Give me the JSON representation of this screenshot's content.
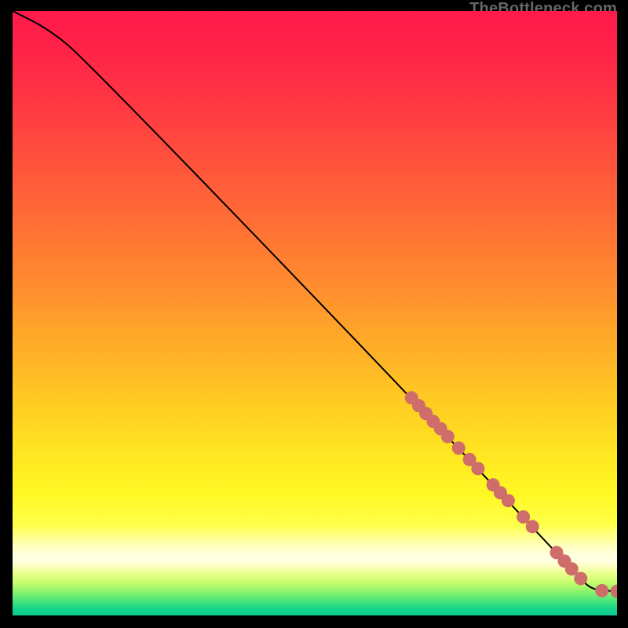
{
  "watermark": "TheBottleneck.com",
  "chart_data": {
    "type": "line",
    "title": "",
    "xlabel": "",
    "ylabel": "",
    "xlim": [
      0,
      100
    ],
    "ylim": [
      0,
      100
    ],
    "curve": [
      {
        "x": 0,
        "y": 100
      },
      {
        "x": 6,
        "y": 97
      },
      {
        "x": 12,
        "y": 92
      },
      {
        "x": 66,
        "y": 36
      },
      {
        "x": 94,
        "y": 6
      },
      {
        "x": 96,
        "y": 4.2
      },
      {
        "x": 100,
        "y": 4
      }
    ],
    "markers": [
      {
        "x": 66.0,
        "y": 36.0
      },
      {
        "x": 67.2,
        "y": 34.7
      },
      {
        "x": 68.4,
        "y": 33.4
      },
      {
        "x": 69.6,
        "y": 32.1
      },
      {
        "x": 70.8,
        "y": 30.9
      },
      {
        "x": 72.0,
        "y": 29.6
      },
      {
        "x": 73.8,
        "y": 27.7
      },
      {
        "x": 75.6,
        "y": 25.8
      },
      {
        "x": 77.0,
        "y": 24.3
      },
      {
        "x": 79.5,
        "y": 21.6
      },
      {
        "x": 80.7,
        "y": 20.3
      },
      {
        "x": 82.0,
        "y": 19.0
      },
      {
        "x": 84.5,
        "y": 16.3
      },
      {
        "x": 86.0,
        "y": 14.7
      },
      {
        "x": 90.0,
        "y": 10.4
      },
      {
        "x": 91.3,
        "y": 9.0
      },
      {
        "x": 92.5,
        "y": 7.7
      },
      {
        "x": 94.0,
        "y": 6.1
      },
      {
        "x": 97.5,
        "y": 4.1
      },
      {
        "x": 100.0,
        "y": 4.0
      }
    ],
    "marker_color": "#cf6d6a",
    "curve_color": "#000000",
    "background_gradient": [
      {
        "stop": 0.0,
        "color": "#ff1a4b"
      },
      {
        "stop": 0.06,
        "color": "#ff2248"
      },
      {
        "stop": 0.14,
        "color": "#ff3443"
      },
      {
        "stop": 0.22,
        "color": "#ff4a3e"
      },
      {
        "stop": 0.3,
        "color": "#ff6038"
      },
      {
        "stop": 0.38,
        "color": "#ff7733"
      },
      {
        "stop": 0.46,
        "color": "#ff8e2e"
      },
      {
        "stop": 0.52,
        "color": "#ffa229"
      },
      {
        "stop": 0.58,
        "color": "#ffb526"
      },
      {
        "stop": 0.64,
        "color": "#ffc923"
      },
      {
        "stop": 0.7,
        "color": "#ffdc21"
      },
      {
        "stop": 0.76,
        "color": "#ffee22"
      },
      {
        "stop": 0.8,
        "color": "#fff825"
      },
      {
        "stop": 0.85,
        "color": "#ffff4a"
      },
      {
        "stop": 0.885,
        "color": "#ffffbe"
      },
      {
        "stop": 0.905,
        "color": "#ffffe8"
      },
      {
        "stop": 0.915,
        "color": "#ffffd0"
      },
      {
        "stop": 0.93,
        "color": "#eaff8d"
      },
      {
        "stop": 0.945,
        "color": "#c9fd6d"
      },
      {
        "stop": 0.96,
        "color": "#8ef46c"
      },
      {
        "stop": 0.975,
        "color": "#4ee579"
      },
      {
        "stop": 0.99,
        "color": "#14d38a"
      },
      {
        "stop": 1.0,
        "color": "#05cc8f"
      }
    ]
  }
}
